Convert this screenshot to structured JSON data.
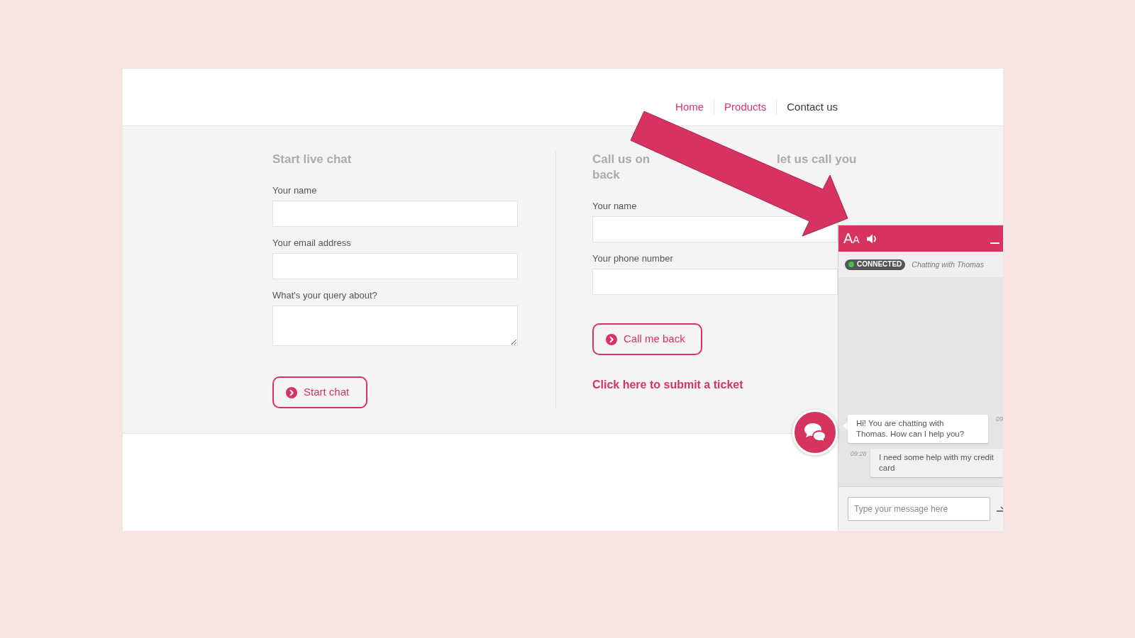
{
  "nav": {
    "items": [
      {
        "label": "Home",
        "selected": false
      },
      {
        "label": "Products",
        "selected": false
      },
      {
        "label": "Contact us",
        "selected": true
      }
    ]
  },
  "live_chat_form": {
    "title": "Start live chat",
    "fields": [
      {
        "label": "Your name",
        "kind": "input"
      },
      {
        "label": "Your email address",
        "kind": "input"
      },
      {
        "label": "What's your query about?",
        "kind": "textarea"
      }
    ],
    "button": "Start chat"
  },
  "callback_form": {
    "title_fragments": [
      "Call us on",
      "let us call you",
      "back"
    ],
    "fields": [
      {
        "label": "Your name",
        "kind": "input"
      },
      {
        "label": "Your phone number",
        "kind": "input"
      }
    ],
    "button": "Call me back",
    "ticket_link": "Click here to submit a ticket"
  },
  "chat_widget": {
    "text_size_button": "AA",
    "status": "CONNECTED",
    "connected": true,
    "agent_line": "Chatting with Thomas",
    "messages": [
      {
        "kind": "agent",
        "text": "Hi! You are chatting with Thomas. How can I help you?",
        "time": "09"
      },
      {
        "kind": "visitor",
        "text": "I need some help with my credit card",
        "time": "09:28"
      }
    ],
    "input": {
      "placeholder": "Type your message here"
    }
  }
}
